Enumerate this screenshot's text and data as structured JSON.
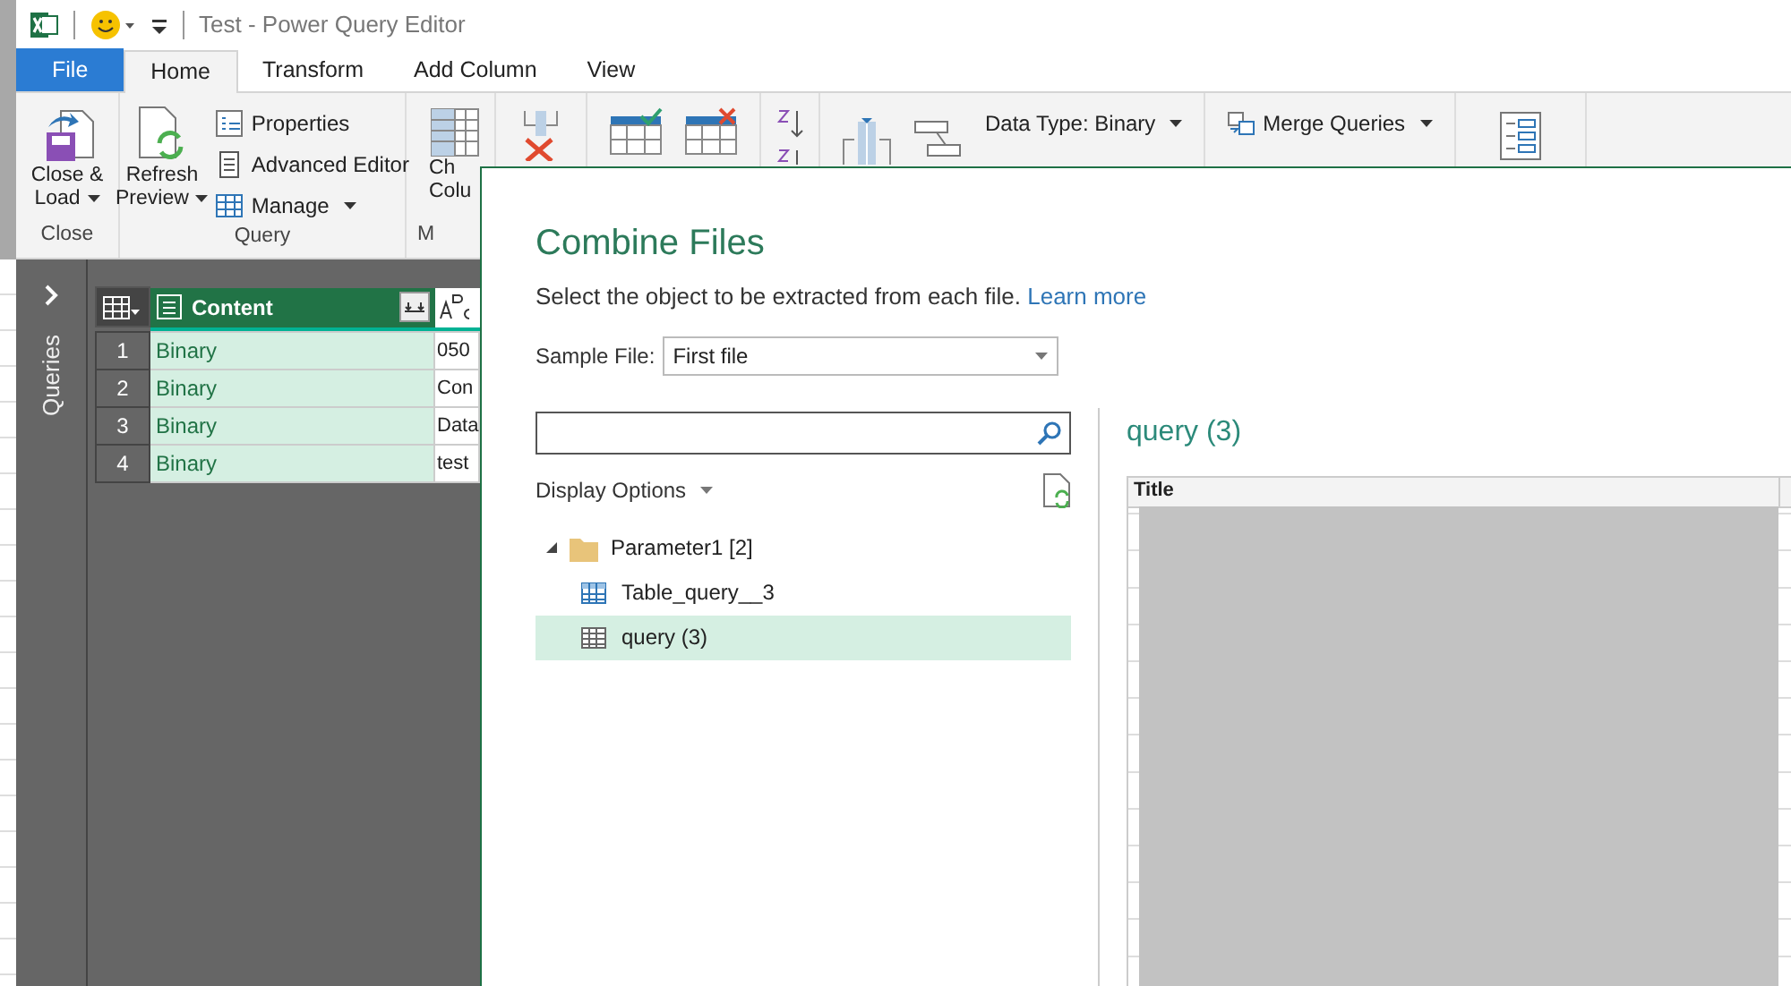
{
  "title_bar": {
    "title": "Test - Power Query Editor"
  },
  "tabs": [
    {
      "label": "File",
      "kind": "file",
      "selected": false
    },
    {
      "label": "Home",
      "kind": "tab",
      "selected": true
    },
    {
      "label": "Transform",
      "kind": "tab",
      "selected": false
    },
    {
      "label": "Add Column",
      "kind": "tab",
      "selected": false
    },
    {
      "label": "View",
      "kind": "tab",
      "selected": false
    }
  ],
  "ribbon": {
    "close_group": {
      "button": [
        "Close &",
        "Load"
      ],
      "label": "Close"
    },
    "query_group": {
      "refresh": [
        "Refresh",
        "Preview"
      ],
      "items": [
        {
          "label": "Properties",
          "dropdown": false
        },
        {
          "label": "Advanced Editor",
          "dropdown": false
        },
        {
          "label": "Manage",
          "dropdown": true
        }
      ],
      "label": "Query"
    },
    "manage_group": {
      "button": [
        "Ch",
        "Colu"
      ],
      "label": "M"
    },
    "transform_items": [
      {
        "label": "Data Type: Binary",
        "dropdown": true
      }
    ],
    "combine_items": [
      {
        "label": "Merge Queries",
        "dropdown": true
      }
    ]
  },
  "queries_pane": {
    "label": "Queries"
  },
  "grid": {
    "columns": [
      {
        "name": "Content",
        "selected": true
      },
      {
        "selected": false
      }
    ],
    "rows": [
      {
        "index": "1",
        "content": "Binary",
        "column_2": "050"
      },
      {
        "index": "2",
        "content": "Binary",
        "column_2": "Con"
      },
      {
        "index": "3",
        "content": "Binary",
        "column_2": "Data"
      },
      {
        "index": "4",
        "content": "Binary",
        "column_2": "test"
      }
    ]
  },
  "dialog": {
    "title": "Combine Files",
    "description": "Select the object to be extracted from each file.",
    "link": "Learn more",
    "sample_file_label": "Sample File:",
    "sample_file_value": "First file",
    "display_options": "Display Options",
    "tree": [
      {
        "label": "Parameter1 [2]",
        "kind": "folder",
        "expanded": true,
        "selected": false,
        "children": [
          {
            "label": "Table_query__3",
            "kind": "table",
            "selected": false
          },
          {
            "label": "query (3)",
            "kind": "sheet",
            "selected": true
          }
        ]
      }
    ],
    "preview": {
      "title": "query (3)",
      "columns": [
        "Title"
      ]
    }
  }
}
